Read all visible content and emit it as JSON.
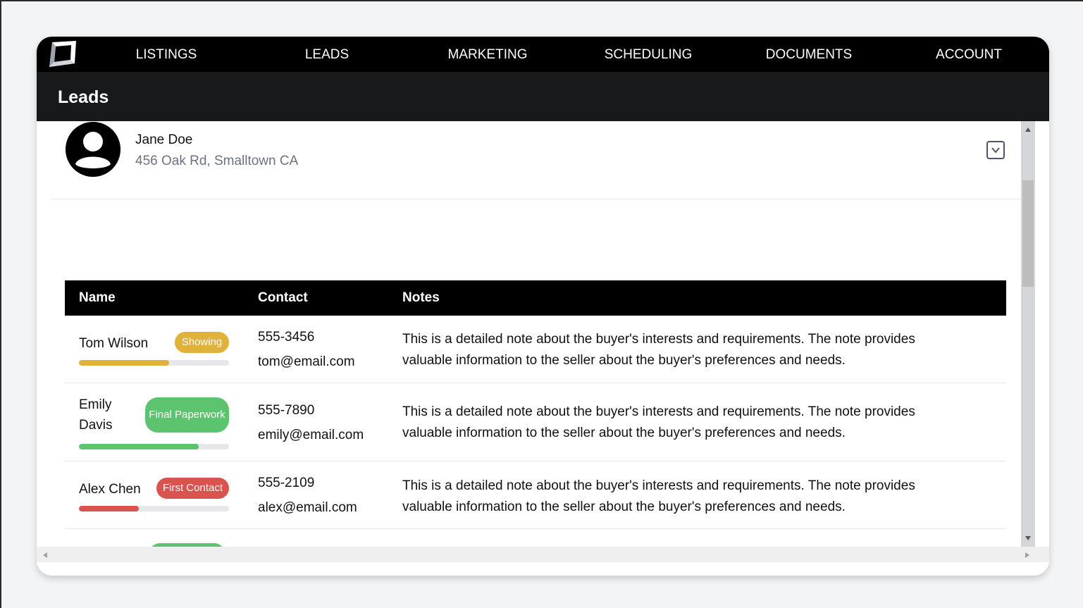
{
  "nav": {
    "items": [
      "LISTINGS",
      "LEADS",
      "MARKETING",
      "SCHEDULING",
      "DOCUMENTS",
      "ACCOUNT"
    ]
  },
  "page": {
    "title": "Leads"
  },
  "lead": {
    "name": "Jane Doe",
    "address": "456 Oak Rd, Smalltown CA"
  },
  "table": {
    "headers": {
      "name": "Name",
      "contact": "Contact",
      "notes": "Notes"
    },
    "rows": [
      {
        "name": "Tom Wilson",
        "status": "Showing",
        "status_color": "#e0b23a",
        "progress": 0.6,
        "phone": "555-3456",
        "email": "tom@email.com",
        "notes": "This is a detailed note about the buyer's interests and requirements. The note provides valuable information to the seller about the buyer's preferences and needs."
      },
      {
        "name": "Emily Davis",
        "status": "Final Paperwork",
        "status_color": "#5cc46e",
        "progress": 0.8,
        "phone": "555-7890",
        "email": "emily@email.com",
        "notes": "This is a detailed note about the buyer's interests and requirements. The note provides valuable information to the seller about the buyer's preferences and needs."
      },
      {
        "name": "Alex Chen",
        "status": "First Contact",
        "status_color": "#d9534f",
        "progress": 0.4,
        "phone": "555-2109",
        "email": "alex@email.com",
        "notes": "This is a detailed note about the buyer's interests and requirements. The note provides valuable information to the seller about the buyer's preferences and needs."
      }
    ]
  },
  "colors": {
    "nav_bg": "#000000",
    "subheader_bg": "#18191b",
    "table_header_bg": "#000000"
  }
}
